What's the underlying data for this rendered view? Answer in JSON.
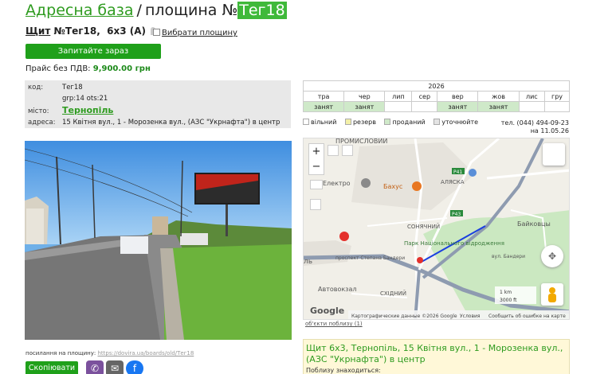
{
  "header": {
    "crumb": "Адресна база",
    "separator": "/",
    "title_prefix": "площина №",
    "code": "Тег18"
  },
  "subheader": {
    "shield": "Щит",
    "code": "№Тег18,",
    "format": "6х3 (А)",
    "select_label": "Вибрати площину"
  },
  "order_button": "Запитайте зараз",
  "price": {
    "label": "Прайс без ПДВ:",
    "value": "9,900.00 грн"
  },
  "info": {
    "code_key": "код:",
    "code_val": "Тег18",
    "grp": "grp:14   ots:21",
    "city_key": "місто:",
    "city_val": "Тернопіль",
    "addr_key": "адреса:",
    "addr_val": "15 Квітня вул., 1 - Морозенка вул., (АЗС \"Укрнафта\") в центр"
  },
  "calendar": {
    "year": "2026",
    "months": [
      "тра",
      "чер",
      "лип",
      "сер",
      "вер",
      "жов",
      "лис",
      "гру"
    ],
    "status": [
      "занят",
      "занят",
      "",
      "",
      "занят",
      "занят",
      "",
      ""
    ]
  },
  "legend": [
    {
      "label": "вільний",
      "color": "#ffffff"
    },
    {
      "label": "резерв",
      "color": "#f3f0a8"
    },
    {
      "label": "проданий",
      "color": "#cfe9c9"
    },
    {
      "label": "уточнюйте",
      "color": "#e4e4e4"
    }
  ],
  "phone": "тел. (044) 494-09-23",
  "updated": "на 11.05.26",
  "map": {
    "labels": [
      "ПРОМИСЛОВИЙ",
      "Бахус",
      "Електро",
      "АЛЯСКА",
      "СОНЯЧНИЙ",
      "Байковцы",
      "Парк Національного відродження",
      "Автовокзал",
      "СХІДНИЙ",
      "проспект Степана Бандери",
      "вул. Бандери",
      "ль"
    ],
    "roads": [
      "P41",
      "P43"
    ],
    "attribution": "Картографические данные ©2026 Google",
    "terms": "Условия",
    "report": "Сообщить об ошибке на карте",
    "scale_km": "1 km",
    "scale_ft": "3000 ft",
    "brand": "Google"
  },
  "map_link": "об'єкти поблизу (1)",
  "share": {
    "label": "посилання на площину:",
    "url": "https://dovira.ua/boards/old/Тег18"
  },
  "copy_button": "Скопіювати",
  "address_box": {
    "text": "Щит 6х3, Тернопіль, 15 Квітня вул., 1 - Морозенка вул., (АЗС \"Укрнафта\") в центр",
    "near": "Поблизу знаходиться:"
  },
  "colors": {
    "accent": "#1fa01a",
    "link": "#2e9b1f"
  },
  "icons": [
    "viber-icon",
    "mail-icon",
    "facebook-icon",
    "pin-icon",
    "zoom-in-icon",
    "zoom-out-icon",
    "layers-icon",
    "pegman-icon",
    "locate-icon"
  ]
}
